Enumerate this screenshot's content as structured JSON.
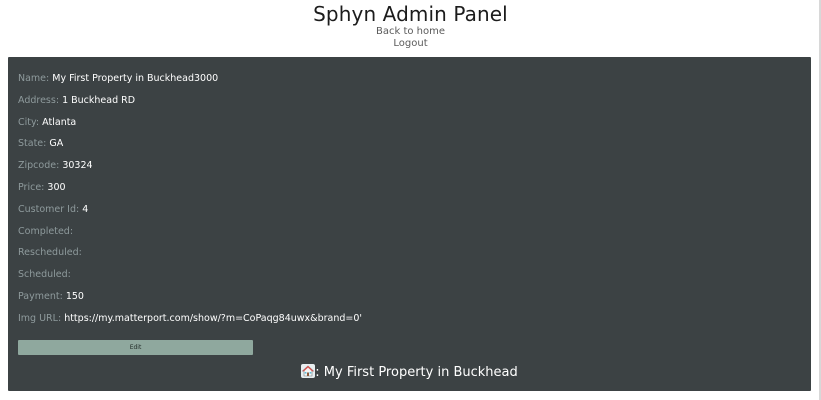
{
  "header": {
    "title": "Sphyn Admin Panel",
    "back_link": "Back to home",
    "logout_link": "Logout"
  },
  "property": {
    "fields": [
      {
        "label": "Name:",
        "value": "My First Property in Buckhead3000"
      },
      {
        "label": "Address:",
        "value": "1 Buckhead RD"
      },
      {
        "label": "City:",
        "value": "Atlanta"
      },
      {
        "label": "State:",
        "value": "GA"
      },
      {
        "label": "Zipcode:",
        "value": "30324"
      },
      {
        "label": "Price:",
        "value": "300"
      },
      {
        "label": "Customer Id:",
        "value": "4"
      },
      {
        "label": "Completed:",
        "value": ""
      },
      {
        "label": "Rescheduled:",
        "value": ""
      },
      {
        "label": "Scheduled:",
        "value": ""
      },
      {
        "label": "Payment:",
        "value": "150"
      },
      {
        "label": "Img URL:",
        "value": "https://my.matterport.com/show/?m=CoPaqg84uwx&brand=0'"
      }
    ],
    "edit_label": "Edit",
    "footer_separator": ":",
    "footer_name": "My First Property in Buckhead"
  },
  "icons": {
    "footer_icon": "home-icon"
  },
  "colors": {
    "panel_bg": "#3c4244",
    "label": "#8e9a9c",
    "value": "#ffffff",
    "edit_button": "#8fa89e"
  }
}
